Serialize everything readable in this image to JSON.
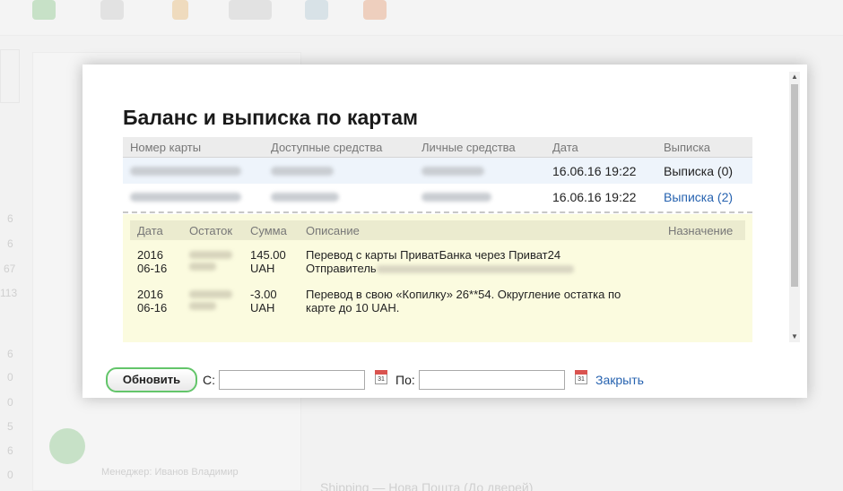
{
  "background": {
    "manager_text": "Менеджер: Иванов Владимир",
    "shipping_text": "Shipping — Нова Пошта (До дверей)",
    "sidebar_numbers": [
      "6",
      "6",
      "67",
      "113",
      "6",
      "0",
      "0",
      "5",
      "6",
      "0"
    ]
  },
  "modal": {
    "title": "Баланс и выписка по картам",
    "cards_table": {
      "headers": [
        "Номер карты",
        "Доступные средства",
        "Личные средства",
        "Дата",
        "Выписка"
      ],
      "rows": [
        {
          "date": "16.06.16 19:22",
          "statement_link": "Выписка (0)"
        },
        {
          "date": "16.06.16 19:22",
          "statement_link": "Выписка (2)"
        }
      ]
    },
    "statement_table": {
      "headers": [
        "Дата",
        "Остаток",
        "Сумма",
        "Описание",
        "Назначение"
      ],
      "rows": [
        {
          "date_line1": "2016",
          "date_line2": "06-16",
          "amount_line1": "145.00",
          "amount_line2": "UAH",
          "desc_line1": "Перевод с карты ПриватБанка через Приват24",
          "desc_line2": "Отправитель"
        },
        {
          "date_line1": "2016",
          "date_line2": "06-16",
          "amount_line1": "-3.00",
          "amount_line2": "UAH",
          "desc_line1": "Перевод в свою «Копилку» 26**54. Округление остатка по",
          "desc_line2": "карте до 10 UAH."
        }
      ]
    },
    "controls": {
      "refresh_label": "Обновить",
      "from_label": "С:",
      "to_label": "По:",
      "from_value": "",
      "to_value": "",
      "calendar_day": "31",
      "close_label": "Закрыть"
    }
  },
  "colors": {
    "link": "#2763b0",
    "refresh_border": "#63c56a",
    "statement_bg": "#fbfbdf"
  }
}
